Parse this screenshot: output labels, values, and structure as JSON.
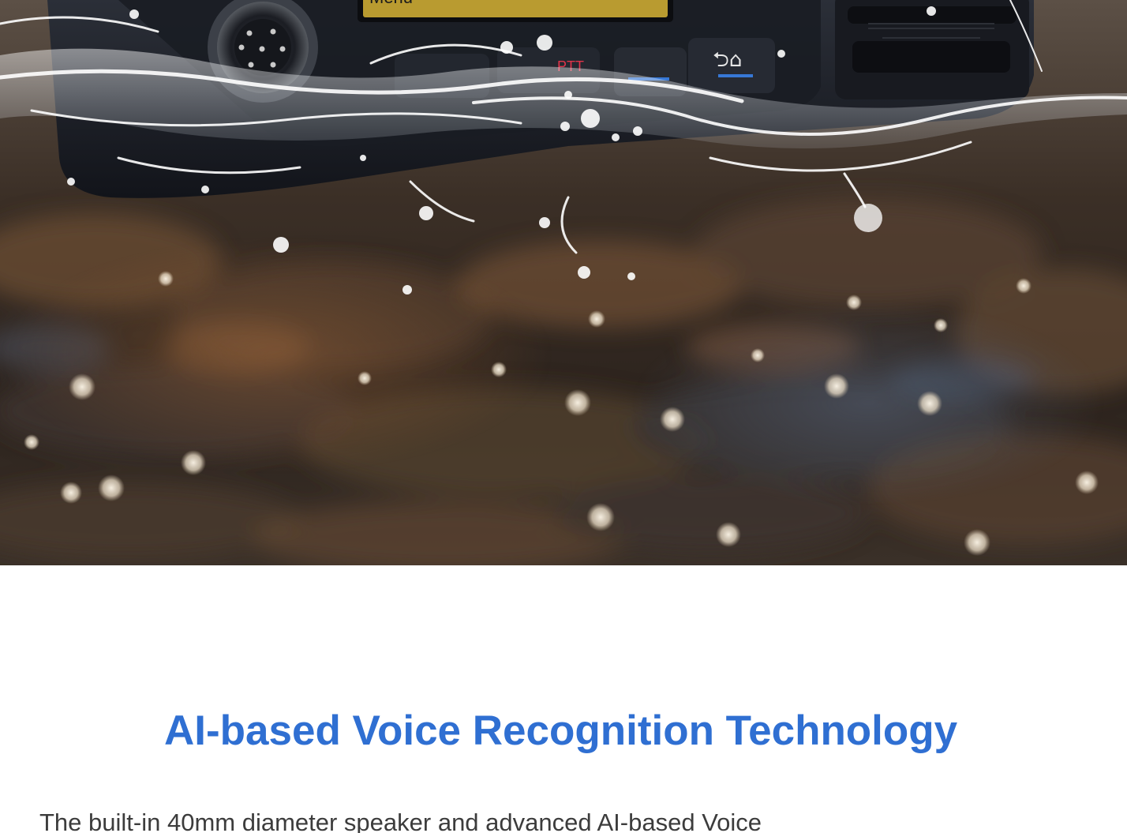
{
  "hero": {
    "radio_display_label": "Menu",
    "radio_key_label": "PTT",
    "colors": {
      "water_highlight": "#ffffff",
      "radio_body": "#1c1f26",
      "bokeh_brown": "#6b4a30"
    }
  },
  "feature": {
    "icon": "sound-wave-icon",
    "title": "AI-based Voice Recognition Technology",
    "description": "The built-in 40mm diameter speaker and advanced AI-based Voice",
    "colors": {
      "title": "#2f6fd2",
      "icon_gradient_start": "#1ec8ee",
      "icon_gradient_end": "#2f73d8",
      "description": "#3c3c3c"
    }
  }
}
